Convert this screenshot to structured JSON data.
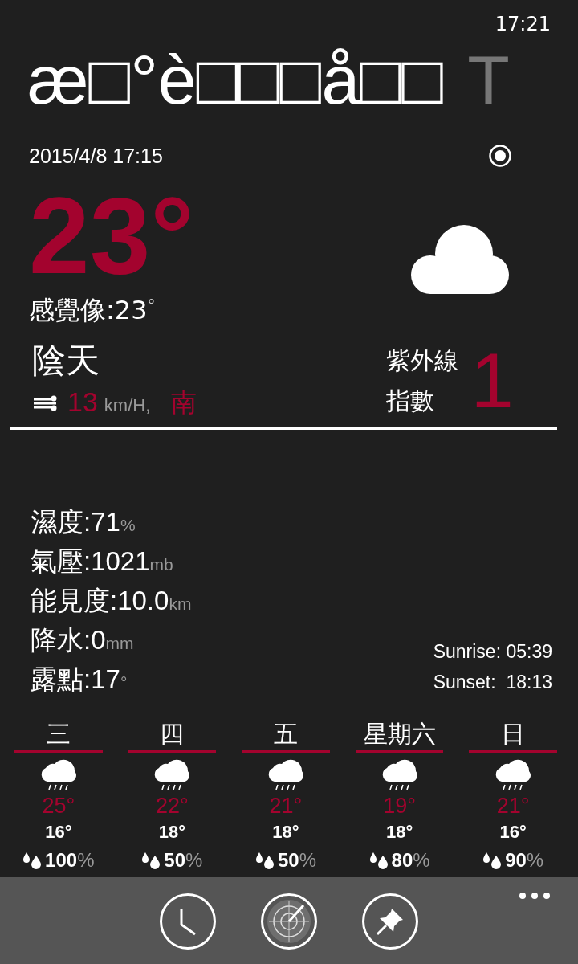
{
  "status_bar": {
    "time": "17:21"
  },
  "pivot": {
    "title": "æ□°è□□□å□□",
    "next_title": "T"
  },
  "updated": "2015/4/8 17:15",
  "current": {
    "temperature": "23°",
    "feels_like": {
      "label": "感覺像:",
      "value": "23",
      "unit": "°"
    },
    "condition": "陰天",
    "wind": {
      "speed": "13",
      "unit": "km/H,",
      "direction": "南"
    },
    "uv": {
      "label_1": "紫外線",
      "label_2": "指數",
      "value": "1"
    }
  },
  "details": [
    {
      "label": "濕度:",
      "value": "71",
      "unit": "%"
    },
    {
      "label": "氣壓:",
      "value": "1021",
      "unit": "mb"
    },
    {
      "label": "能見度:",
      "value": "10.0",
      "unit": "km"
    },
    {
      "label": "降水:",
      "value": "0",
      "unit": "mm"
    },
    {
      "label": "露點:",
      "value": "17",
      "unit": "°"
    }
  ],
  "sun": {
    "sunrise": "Sunrise: 05:39",
    "sunset": "Sunset:  18:13"
  },
  "forecast": [
    {
      "day": "三",
      "high": "25°",
      "low": "16°",
      "precip": "100",
      "unit": "%"
    },
    {
      "day": "四",
      "high": "22°",
      "low": "18°",
      "precip": "50",
      "unit": "%"
    },
    {
      "day": "五",
      "high": "21°",
      "low": "18°",
      "precip": "50",
      "unit": "%"
    },
    {
      "day": "星期六",
      "high": "19°",
      "low": "18°",
      "precip": "80",
      "unit": "%"
    },
    {
      "day": "日",
      "high": "21°",
      "low": "16°",
      "precip": "90",
      "unit": "%"
    }
  ],
  "app_bar": {
    "buttons": [
      {
        "kind": "clock"
      },
      {
        "kind": "radar"
      },
      {
        "kind": "pin"
      }
    ]
  }
}
